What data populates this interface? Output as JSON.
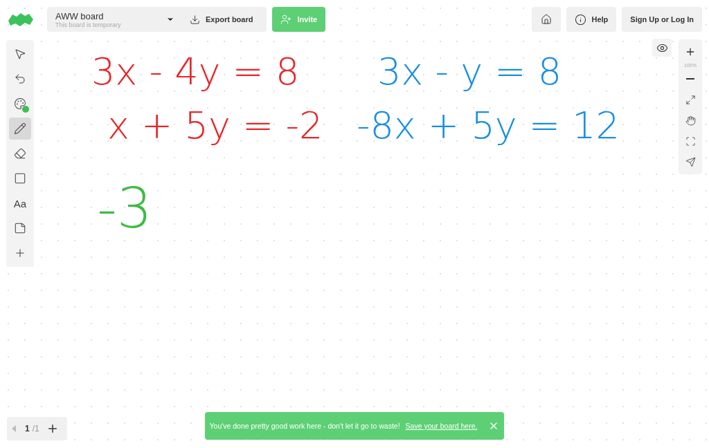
{
  "header": {
    "board_title": "AWW board",
    "board_subtitle": "This board is temporary",
    "export_label": "Export board",
    "invite_label": "Invite",
    "help_label": "Help",
    "sign_in_label": "Sign Up or Log In"
  },
  "tools": [
    {
      "kind": "select",
      "selected": false
    },
    {
      "kind": "undo",
      "selected": false
    },
    {
      "kind": "palette",
      "selected": false,
      "color": "#3dbf55"
    },
    {
      "kind": "pencil",
      "selected": true
    },
    {
      "kind": "eraser",
      "selected": false
    },
    {
      "kind": "rectangle",
      "selected": false
    },
    {
      "kind": "text",
      "label": "Aa",
      "selected": false
    },
    {
      "kind": "note",
      "selected": false
    },
    {
      "kind": "add",
      "selected": false
    }
  ],
  "zoom": {
    "reading": "100%"
  },
  "board": {
    "writing": [
      {
        "text": "3x - 4y = 8",
        "color": "#e8262a"
      },
      {
        "text": "3x - y = 8",
        "color": "#1a8fe0"
      },
      {
        "text": "x + 5y = -2",
        "color": "#e8262a"
      },
      {
        "text": "-8x + 5y = 12",
        "color": "#1a8fe0"
      },
      {
        "text": "-3",
        "color": "#3dbb45"
      }
    ]
  },
  "pages": {
    "current": "1",
    "total": "/1"
  },
  "toast": {
    "message": "You've done pretty good work here - don't let it go to waste!",
    "link": "Save your board here."
  }
}
